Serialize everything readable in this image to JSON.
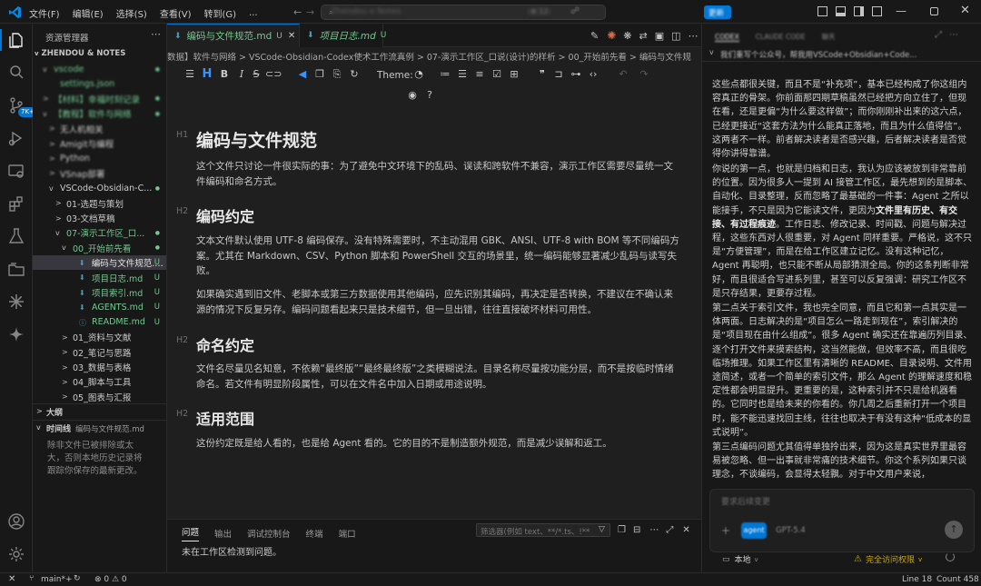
{
  "titlebar": {
    "menus": [
      "文件(F)",
      "编辑(E)",
      "选择(S)",
      "查看(V)",
      "转到(G)",
      "..."
    ],
    "search_text": "Zhendou e Notes",
    "chip_text": "⊕ 12",
    "upgrade_label": "更新"
  },
  "sidebar": {
    "title": "资源管理器",
    "workspace": "ZHENDOU & NOTES",
    "tree": [
      {
        "label": "vscode",
        "indent": 1,
        "chev": "v",
        "color": "#73c991",
        "status": "●",
        "blur": true
      },
      {
        "label": "settings.json",
        "indent": 2,
        "chev": "",
        "color": "#73c991",
        "status": "",
        "blur": true
      },
      {
        "label": "【材料】幸福时刻记录",
        "indent": 1,
        "chev": ">",
        "color": "#73c991",
        "status": "●",
        "blur": true
      },
      {
        "label": "【教程】软件与网络",
        "indent": 1,
        "chev": "v",
        "color": "#73c991",
        "status": "●",
        "blur": true
      },
      {
        "label": "无人机相关",
        "indent": 2,
        "chev": ">",
        "color": "#cccccc",
        "status": "",
        "blur": true
      },
      {
        "label": "Amigit与编程",
        "indent": 2,
        "chev": ">",
        "color": "#cccccc",
        "status": "",
        "blur": true
      },
      {
        "label": "Python",
        "indent": 2,
        "chev": ">",
        "color": "#cccccc",
        "status": "",
        "blur": true
      },
      {
        "label": "VSnap部署",
        "indent": 2,
        "chev": ">",
        "color": "#cccccc",
        "status": "",
        "blur": true
      },
      {
        "label": "VSCode-Obsidian-C...",
        "indent": 2,
        "chev": "v",
        "color": "#cccccc",
        "status": "●"
      },
      {
        "label": "01-选题与策划",
        "indent": 3,
        "chev": ">",
        "color": "#cccccc",
        "status": ""
      },
      {
        "label": "03-文档草稿",
        "indent": 3,
        "chev": ">",
        "color": "#cccccc",
        "status": ""
      },
      {
        "label": "07-演示工作区_口...",
        "indent": 3,
        "chev": "v",
        "color": "#73c991",
        "status": "●"
      },
      {
        "label": "00_开始前先看",
        "indent": 4,
        "chev": "v",
        "color": "#73c991",
        "status": "●"
      },
      {
        "label": "编码与文件规范.md",
        "indent": 5,
        "chev": "",
        "icon": "md",
        "color": "#e7e7e7",
        "status": "U",
        "selected": true
      },
      {
        "label": "项目日志.md",
        "indent": 5,
        "chev": "",
        "icon": "md",
        "color": "#73c991",
        "status": "U"
      },
      {
        "label": "项目索引.md",
        "indent": 5,
        "chev": "",
        "icon": "md",
        "color": "#73c991",
        "status": "U"
      },
      {
        "label": "AGENTS.md",
        "indent": 5,
        "chev": "",
        "icon": "md",
        "color": "#73c991",
        "status": "U"
      },
      {
        "label": "README.md",
        "indent": 5,
        "chev": "",
        "icon": "info",
        "color": "#73c991",
        "status": "U"
      },
      {
        "label": "01_资料与文献",
        "indent": 4,
        "chev": ">",
        "color": "#cccccc",
        "status": ""
      },
      {
        "label": "02_笔记与思路",
        "indent": 4,
        "chev": ">",
        "color": "#cccccc",
        "status": ""
      },
      {
        "label": "03_数据与表格",
        "indent": 4,
        "chev": ">",
        "color": "#cccccc",
        "status": ""
      },
      {
        "label": "04_脚本与工具",
        "indent": 4,
        "chev": ">",
        "color": "#cccccc",
        "status": ""
      },
      {
        "label": "05_图表与汇报",
        "indent": 4,
        "chev": ">",
        "color": "#cccccc",
        "status": ""
      }
    ],
    "outline_title": "大纲",
    "timeline_title": "时间线",
    "timeline_file": "编码与文件规范.md",
    "timeline_text": "除非文件已被排除或太大，否则本地历史记录将跟踪你保存的最新更改。"
  },
  "editor": {
    "tabs": [
      {
        "label": "编码与文件规范.md",
        "status": "U",
        "active": true
      },
      {
        "label": "项目日志.md",
        "status": "U",
        "active": false
      }
    ],
    "breadcrumb": "数据】软件与网络 > VSCode-Obsidian-Codex使术工作流真例 > 07-演示工作区_口说(设计)的样析 > 00_开始前先看 > 编码与文件规",
    "theme_label": "Theme:",
    "doc": {
      "h1": "编码与文件规范",
      "intro": "这个文件只讨论一件很实际的事：为了避免中文环境下的乱码、误读和跨软件不兼容，演示工作区需要尽量统一文件编码和命名方式。",
      "sections": [
        {
          "title": "编码约定",
          "paras": [
            "文本文件默认使用 UTF-8 编码保存。没有特殊需要时，不主动混用 GBK、ANSI、UTF-8 with BOM 等不同编码方案。尤其在 Markdown、CSV、Python 脚本和 PowerShell 交互的场景里，统一编码能够显著减少乱码与读写失败。",
            "如果确实遇到旧文件、老脚本或第三方数据使用其他编码，应先识别其编码，再决定是否转换，不建议在不确认来源的情况下反复另存。编码问题看起来只是技术细节，但一旦出错，往往直接破坏材料可用性。"
          ]
        },
        {
          "title": "命名约定",
          "paras": [
            "文件名尽量见名知意，不依赖“最终版”“最终最终版”之类模糊说法。目录名称尽量按功能分层，而不是按临时情绪命名。若文件有明显阶段属性，可以在文件名中加入日期或用途说明。"
          ]
        },
        {
          "title": "适用范围",
          "paras": [
            "这份约定既是给人看的，也是给 Agent 看的。它的目的不是制造额外规范，而是减少误解和返工。"
          ]
        }
      ]
    }
  },
  "panel": {
    "tabs": [
      "问题",
      "输出",
      "调试控制台",
      "终端",
      "端口"
    ],
    "filter_placeholder": "筛选器(例如 text、**/*.ts、!**/...",
    "message": "未在工作区检测到问题。"
  },
  "chat": {
    "tabs": [
      "CODEX",
      "CLAUDE CODE",
      "聊天"
    ],
    "header_text": "我们重写个公众号，帮我用VSCode+Obsidian+Code...",
    "paragraphs": [
      [
        [
          "这些点都很关键，而且不是“补充项”，基本已经构成了你这组内容真正的骨架。你前面那四期草稿虽然已经把方向立住了，但现在看，还是更偏“为什么要这样做”；而你刚刚补出来的这六点，已经更接近“这套方法为什么能真正落地，而且为什么值得信”。这两者不一样。前者解决读者是否感兴趣，后者解决读者是否觉得你讲得靠谱。",
          false
        ]
      ],
      [
        [
          "你说的第一点，也就是归档和日志，我认为应该被放到非常靠前的位置。因为很多人一提到 AI 接管工作区，最先想到的是脚本、自动化、目录整理，反而忽略了最基础的一件事：Agent 之所以能接手，不只是因为它能读文件，更因为",
          false
        ],
        [
          "文件里有历史、有交接、有过程痕迹",
          true
        ],
        [
          "。工作日志、修改记录、时间戳、问题与解决过程，这些东西对人很重要，对 Agent 同样重要。严格说，这不只是“方便管理”，而是在给工作区建立记忆。没有这种记忆，Agent 再聪明，也只能不断从局部猜测全局。你的这条判断非常好，而且很适合写进系列里，甚至可以反复强调：研究工作区不是只存结果，更要存过程。",
          false
        ]
      ],
      [
        [
          "第二点关于索引文件，我也完全同意，而且它和第一点其实是一体两面。日志解决的是“项目怎么一路走到现在”，索引解决的是“项目现在由什么组成”。很多 Agent 确实还在靠遍历列目录、逐个打开文件来摸索结构，这当然能做，但效率不高，而且很吃临场推理。如果工作区里有清晰的 README、目录说明、文件用途简述，或者一个简单的索引文件，那么 Agent 的理解速度和稳定性都会明显提升。更重要的是，这种索引并不只是给机器看的。它同时也是给未来的你看的。你几周之后重新打开一个项目时，能不能迅速找回主线，往往也取决于有没有这种“低成本的显式说明”。",
          false
        ]
      ],
      [
        [
          "第三点编码问题尤其值得单独拎出来，因为这是真实世界里最容易被忽略、但一出事就非常痛的技术细节。你这个系列如果只谈理念，不谈编码，会显得太轻飘。对于中文用户来说，",
          false
        ]
      ]
    ],
    "input_placeholder": "要求后续变更",
    "mode_label": "agent",
    "model_label": "GPT-5.4",
    "local_label": "本地",
    "access_label": "完全访问权限"
  },
  "statusbar": {
    "branch": "main*+",
    "problems": "⊗ 0  ⚠ 0",
    "line": "Line 18",
    "count": "Count 458"
  },
  "colors": {
    "accent": "#0078d4",
    "git_untracked": "#73c991",
    "md_icon": "#519aba",
    "warning": "#cca700"
  }
}
